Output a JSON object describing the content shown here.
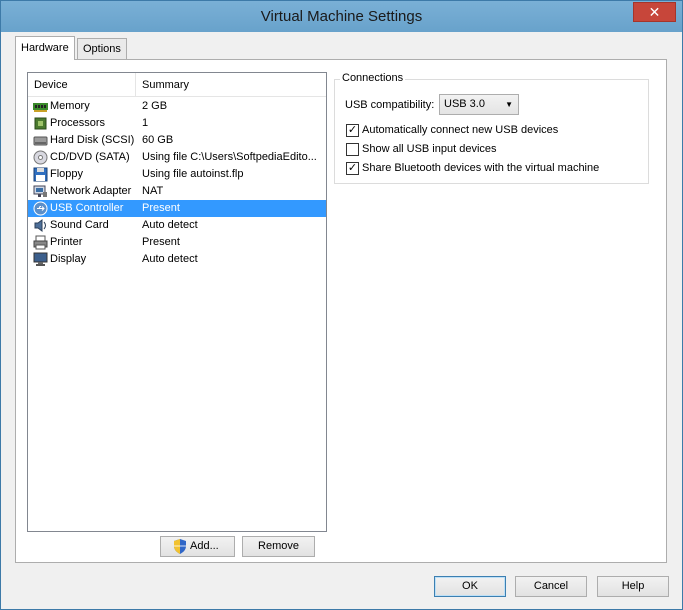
{
  "window": {
    "title": "Virtual Machine Settings",
    "close_glyph": "✕"
  },
  "tabs": [
    {
      "label": "Hardware",
      "active": true
    },
    {
      "label": "Options",
      "active": false
    }
  ],
  "device_list": {
    "columns": {
      "device": "Device",
      "summary": "Summary"
    },
    "items": [
      {
        "icon": "memory-icon",
        "device": "Memory",
        "summary": "2 GB"
      },
      {
        "icon": "processor-icon",
        "device": "Processors",
        "summary": "1"
      },
      {
        "icon": "hard-disk-icon",
        "device": "Hard Disk (SCSI)",
        "summary": "60 GB"
      },
      {
        "icon": "cd-dvd-icon",
        "device": "CD/DVD (SATA)",
        "summary": "Using file C:\\Users\\SoftpediaEdito..."
      },
      {
        "icon": "floppy-icon",
        "device": "Floppy",
        "summary": "Using file autoinst.flp"
      },
      {
        "icon": "network-adapter-icon",
        "device": "Network Adapter",
        "summary": "NAT"
      },
      {
        "icon": "usb-controller-icon",
        "device": "USB Controller",
        "summary": "Present",
        "selected": true
      },
      {
        "icon": "sound-card-icon",
        "device": "Sound Card",
        "summary": "Auto detect"
      },
      {
        "icon": "printer-icon",
        "device": "Printer",
        "summary": "Present"
      },
      {
        "icon": "display-icon",
        "device": "Display",
        "summary": "Auto detect"
      }
    ]
  },
  "list_buttons": {
    "add_label": "Add...",
    "remove_label": "Remove"
  },
  "connections": {
    "group_title": "Connections",
    "usb_compat_label": "USB compatibility:",
    "usb_compat_value": "USB 3.0",
    "options": [
      {
        "label": "Automatically connect new USB devices",
        "checked": true
      },
      {
        "label": "Show all USB input devices",
        "checked": false
      },
      {
        "label": "Share Bluetooth devices with the virtual machine",
        "checked": true
      }
    ]
  },
  "footer": {
    "ok_label": "OK",
    "cancel_label": "Cancel",
    "help_label": "Help"
  },
  "colors": {
    "titlebar": "#6ba6cf",
    "selection": "#3399ff",
    "close_button": "#c7463a"
  }
}
